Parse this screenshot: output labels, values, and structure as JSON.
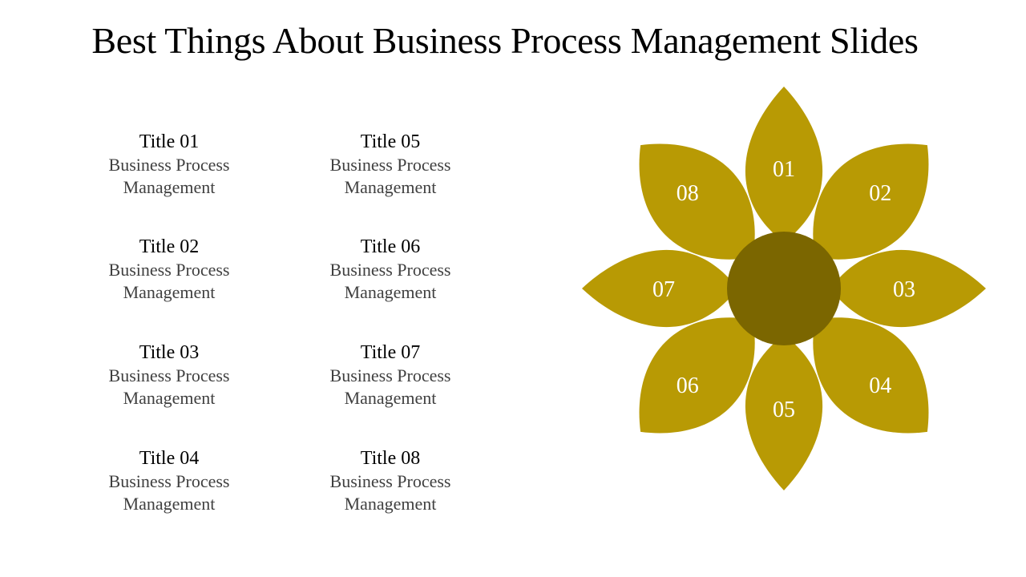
{
  "slide": {
    "title": "Best Things About Business Process Management Slides",
    "colors": {
      "petal": "#B89A04",
      "center": "#7B6600",
      "label": "#FFFFFF"
    }
  },
  "items": [
    {
      "title": "Title 01",
      "line1": "Business Process",
      "line2": "Management"
    },
    {
      "title": "Title 02",
      "line1": "Business Process",
      "line2": "Management"
    },
    {
      "title": "Title 03",
      "line1": "Business Process",
      "line2": "Management"
    },
    {
      "title": "Title 04",
      "line1": "Business Process",
      "line2": "Management"
    },
    {
      "title": "Title 05",
      "line1": "Business Process",
      "line2": "Management"
    },
    {
      "title": "Title 06",
      "line1": "Business Process",
      "line2": "Management"
    },
    {
      "title": "Title 07",
      "line1": "Business Process",
      "line2": "Management"
    },
    {
      "title": "Title 08",
      "line1": "Business Process",
      "line2": "Management"
    }
  ],
  "petals": [
    "01",
    "02",
    "03",
    "04",
    "05",
    "06",
    "07",
    "08"
  ]
}
